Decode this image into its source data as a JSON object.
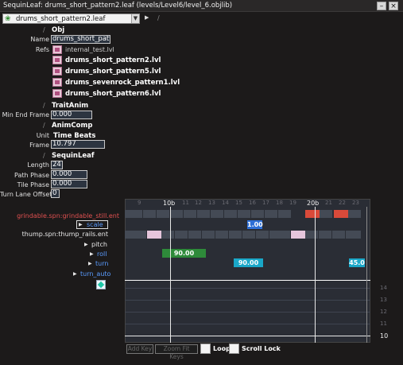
{
  "window": {
    "title": "SequinLeaf: drums_short_pattern2.leaf (levels/Level6/level_6.objlib)"
  },
  "selector": {
    "value": "drums_short_pattern2.leaf"
  },
  "obj": {
    "section": "Obj",
    "name_label": "Name",
    "name_value": "drums_short_pattern",
    "refs_label": "Refs",
    "refs": [
      "internal_test.lvl",
      "drums_short_pattern2.lvl",
      "drums_short_pattern5.lvl",
      "drums_sevenrock_pattern1.lvl",
      "drums_short_pattern6.lvl"
    ]
  },
  "trait_anim": {
    "section": "TraitAnim",
    "min_end_frame_label": "Min End Frame",
    "min_end_frame": "0.000"
  },
  "anim_comp": {
    "section": "AnimComp",
    "unit_label": "Unit",
    "unit_value": "Time Beats",
    "frame_label": "Frame",
    "frame_value": "10.797"
  },
  "sequin_leaf": {
    "section": "SequinLeaf",
    "length_label": "Length",
    "length": "24",
    "path_phase_label": "Path Phase",
    "path_phase": "0.000",
    "tile_phase_label": "Tile Phase",
    "tile_phase": "0.000",
    "turn_lane_offset_label": "Turn Lane Offset",
    "turn_lane_offset": "0"
  },
  "tracks": [
    {
      "label": "grindable.spn:grindable_still.ent",
      "color": "#e05050"
    },
    {
      "label": "scale",
      "color": "#5a9cff"
    },
    {
      "label": "thump.spn:thump_rails.ent",
      "color": "#e8e8e8"
    },
    {
      "label": "pitch",
      "color": "#e8e8e8"
    },
    {
      "label": "roll",
      "color": "#5a9cff"
    },
    {
      "label": "turn",
      "color": "#5a9cff"
    },
    {
      "label": "turn_auto",
      "color": "#5a9cff"
    }
  ],
  "ruler": {
    "ticks": [
      "9",
      "10b",
      "11",
      "12",
      "13",
      "14",
      "15",
      "16",
      "17",
      "18",
      "19",
      "20b",
      "21",
      "22",
      "23"
    ]
  },
  "keys": {
    "scale_value": "1.00",
    "roll_value": "90.00",
    "turn_value": "90.00",
    "turn_value2": "45.0"
  },
  "axis": {
    "labels": [
      "14",
      "13",
      "12",
      "11",
      "10"
    ]
  },
  "bottom": {
    "add_keys": "Add Key",
    "zoom_fit_keys": "Zoom Fit Keys",
    "loop": "Loop",
    "scroll_lock": "Scroll Lock"
  },
  "colors": {
    "red_key": "#d94a3a",
    "pink_key": "#e6c6dc",
    "green_key": "#2e8a3a",
    "cyan_key": "#1aa7c8",
    "blue_key": "#2e6fd6"
  }
}
